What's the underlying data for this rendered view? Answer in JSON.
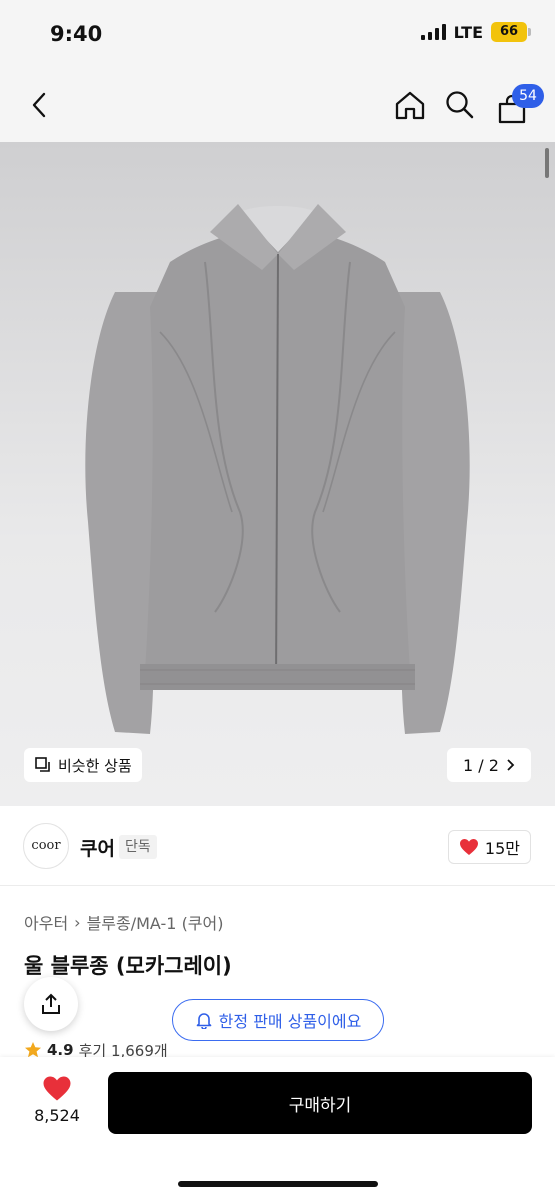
{
  "status_bar": {
    "time": "9:40",
    "network": "LTE",
    "battery": "66"
  },
  "nav": {
    "cart_count": "54",
    "icons": [
      "back-icon",
      "home-icon",
      "search-icon",
      "cart-icon"
    ]
  },
  "hero": {
    "similar_label": "비슷한 상품",
    "pager": "1 / 2"
  },
  "brand": {
    "logo_text": "coor",
    "name": "쿠어",
    "tag": "단독",
    "likes": "15만"
  },
  "product": {
    "breadcrumb": [
      "아우터",
      "블루종/MA-1 (쿠어)"
    ],
    "title": "울 블루종 (모카그레이)",
    "limited_label": "한정 판매 상품이에요",
    "rating": "4.9",
    "review_text": "후기 1,669개"
  },
  "bottom": {
    "wish_count": "8,524",
    "buy_label": "구매하기"
  },
  "colors": {
    "accent": "#2f5fe8",
    "heart": "#e8303a",
    "star": "#f2a81d",
    "buy": "#000000",
    "jacket": "#9d9c9e"
  }
}
